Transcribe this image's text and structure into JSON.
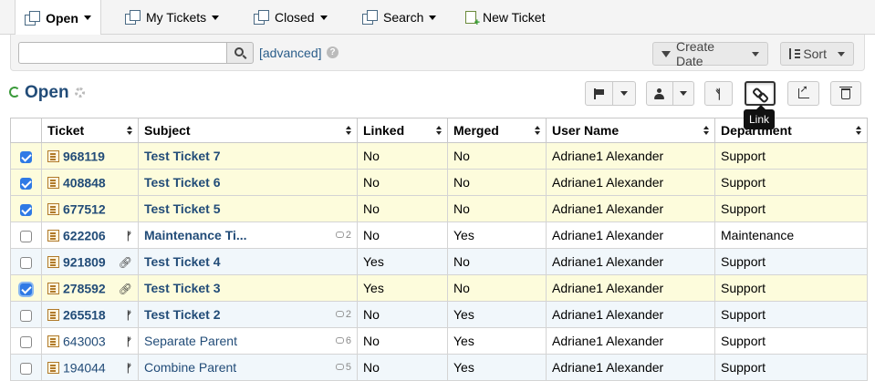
{
  "nav": {
    "tabs": [
      {
        "label": "Open",
        "icon": "tickets-stack-icon",
        "active": true
      },
      {
        "label": "My Tickets",
        "icon": "tickets-stack-icon"
      },
      {
        "label": "Closed",
        "icon": "tickets-stack-icon"
      },
      {
        "label": "Search",
        "icon": "tickets-stack-icon"
      },
      {
        "label": "New Ticket",
        "icon": "new-ticket-icon"
      }
    ]
  },
  "search": {
    "value": "",
    "advanced_label": "[advanced]",
    "create_date_label": "Create Date",
    "sort_label": "Sort"
  },
  "queue": {
    "title": "Open"
  },
  "tooltip": {
    "text": "Link"
  },
  "table": {
    "columns": [
      "Ticket",
      "Subject",
      "Linked",
      "Merged",
      "User Name",
      "Department"
    ],
    "rows": [
      {
        "checked": true,
        "number": "968119",
        "subject": "Test Ticket 7",
        "linked": "No",
        "merged": "No",
        "user": "Adriane1 Alexander",
        "dept": "Support",
        "bold": true,
        "style": "sel",
        "mark": "",
        "threads": ""
      },
      {
        "checked": true,
        "number": "408848",
        "subject": "Test Ticket 6",
        "linked": "No",
        "merged": "No",
        "user": "Adriane1 Alexander",
        "dept": "Support",
        "bold": true,
        "style": "sel",
        "mark": "",
        "threads": ""
      },
      {
        "checked": true,
        "number": "677512",
        "subject": "Test Ticket 5",
        "linked": "No",
        "merged": "No",
        "user": "Adriane1 Alexander",
        "dept": "Support",
        "bold": true,
        "style": "sel",
        "mark": "",
        "threads": ""
      },
      {
        "checked": false,
        "number": "622206",
        "subject": "Maintenance Ti...",
        "linked": "No",
        "merged": "Yes",
        "user": "Adriane1 Alexander",
        "dept": "Maintenance",
        "bold": true,
        "style": "plain",
        "mark": "merge",
        "threads": "2"
      },
      {
        "checked": false,
        "number": "921809",
        "subject": "Test Ticket 4",
        "linked": "Yes",
        "merged": "No",
        "user": "Adriane1 Alexander",
        "dept": "Support",
        "bold": true,
        "style": "alt",
        "mark": "link",
        "threads": ""
      },
      {
        "checked": true,
        "number": "278592",
        "subject": "Test Ticket 3",
        "linked": "Yes",
        "merged": "No",
        "user": "Adriane1 Alexander",
        "dept": "Support",
        "bold": true,
        "style": "sel",
        "mark": "link",
        "threads": "",
        "focus": true
      },
      {
        "checked": false,
        "number": "265518",
        "subject": "Test Ticket 2",
        "linked": "No",
        "merged": "Yes",
        "user": "Adriane1 Alexander",
        "dept": "Support",
        "bold": true,
        "style": "alt",
        "mark": "merge",
        "threads": "2"
      },
      {
        "checked": false,
        "number": "643003",
        "subject": "Separate Parent",
        "linked": "No",
        "merged": "Yes",
        "user": "Adriane1 Alexander",
        "dept": "Support",
        "bold": false,
        "style": "plain",
        "mark": "merge",
        "threads": "6"
      },
      {
        "checked": false,
        "number": "194044",
        "subject": "Combine Parent",
        "linked": "No",
        "merged": "Yes",
        "user": "Adriane1 Alexander",
        "dept": "Support",
        "bold": false,
        "style": "alt",
        "mark": "merge",
        "threads": "5"
      }
    ]
  }
}
